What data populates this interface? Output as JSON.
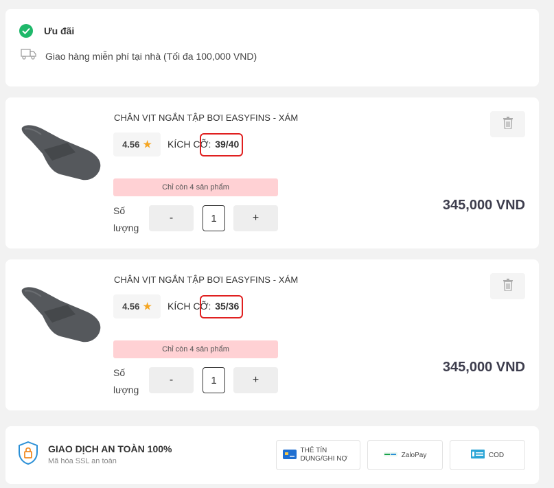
{
  "promo": {
    "title": "Ưu đãi",
    "line": "Giao hàng miễn phí tại nhà (Tối đa 100,000 VND)"
  },
  "products": [
    {
      "name": "CHÂN VỊT NGẮN TẬP BƠI EASYFINS - XÁM",
      "rating": "4.56",
      "size_label": "KÍCH CỠ:",
      "size_value": "39/40",
      "stock": "Chỉ còn 4 sản phẩm",
      "qty_label": "Số lượng",
      "qty_minus": "-",
      "qty_value": "1",
      "qty_plus": "+",
      "price": "345,000 VND"
    },
    {
      "name": "CHÂN VỊT NGẮN TẬP BƠI EASYFINS - XÁM",
      "rating": "4.56",
      "size_label": "KÍCH CỠ:",
      "size_value": "35/36",
      "stock": "Chỉ còn 4 sản phẩm",
      "qty_label": "Số lượng",
      "qty_minus": "-",
      "qty_value": "1",
      "qty_plus": "+",
      "price": "345,000 VND"
    }
  ],
  "secure": {
    "title": "GIAO DỊCH AN TOÀN 100%",
    "subtitle": "Mã hóa SSL an toàn",
    "payments": [
      {
        "label": "THẺ TÍN DỤNG/GHI NỢ",
        "icon": "credit-card-icon"
      },
      {
        "label": "ZaloPay",
        "icon": "zalopay-icon"
      },
      {
        "label": "COD",
        "icon": "cash-icon"
      }
    ]
  },
  "colors": {
    "accent_green": "#1fb86a",
    "stock_badge": "#ffd1d4",
    "highlight_red": "#e02020",
    "star": "#f5a623"
  }
}
